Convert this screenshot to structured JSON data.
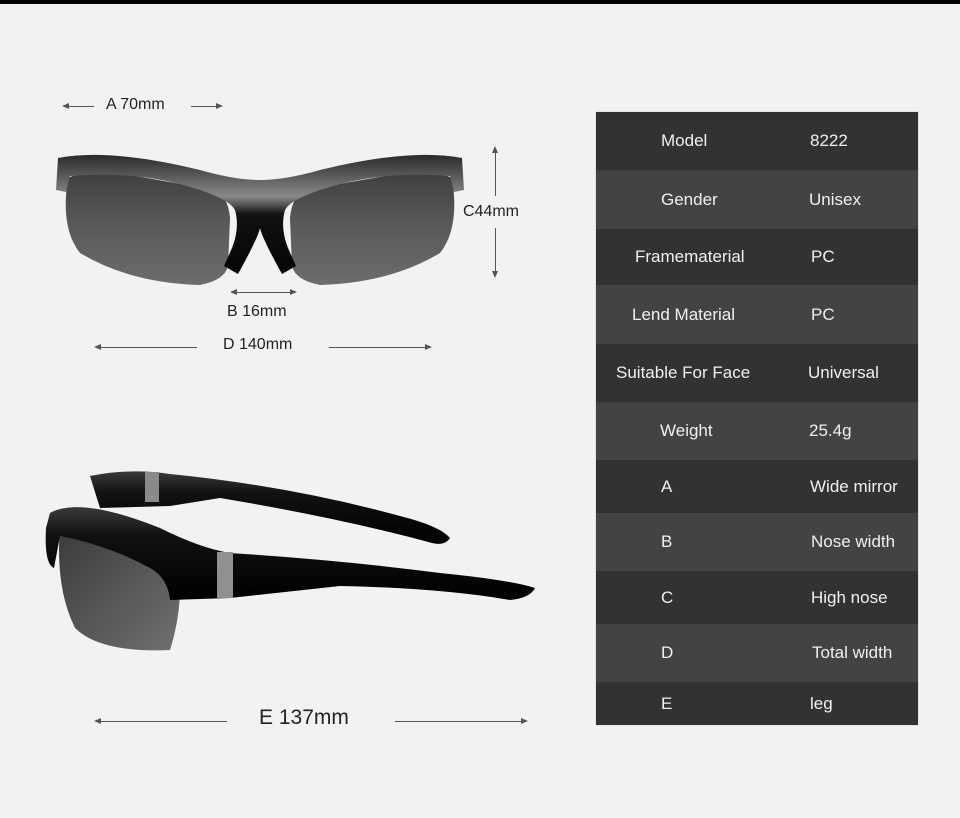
{
  "dimensions": {
    "a": "A 70mm",
    "b": "B 16mm",
    "c": "C44mm",
    "d": "D 140mm",
    "e": "E 137mm"
  },
  "images": {
    "front": "sunglasses-front-view",
    "side": "sunglasses-side-view"
  },
  "colors": {
    "background": "#f2f2f2",
    "row_dark": "#323232",
    "row_light": "#434343",
    "text_light": "#f0f0f0"
  },
  "specs": [
    {
      "key": "Model",
      "value": "8222"
    },
    {
      "key": "Gender",
      "value": "Unisex"
    },
    {
      "key": "Framematerial",
      "value": "PC"
    },
    {
      "key": "Lend Material",
      "value": "PC"
    },
    {
      "key": "Suitable For Face",
      "value": "Universal"
    },
    {
      "key": "Weight",
      "value": "25.4g"
    },
    {
      "key": "A",
      "value": "Wide mirror"
    },
    {
      "key": "B",
      "value": "Nose width"
    },
    {
      "key": "C",
      "value": "High nose"
    },
    {
      "key": "D",
      "value": "Total width"
    },
    {
      "key": "E",
      "value": "leg"
    }
  ]
}
